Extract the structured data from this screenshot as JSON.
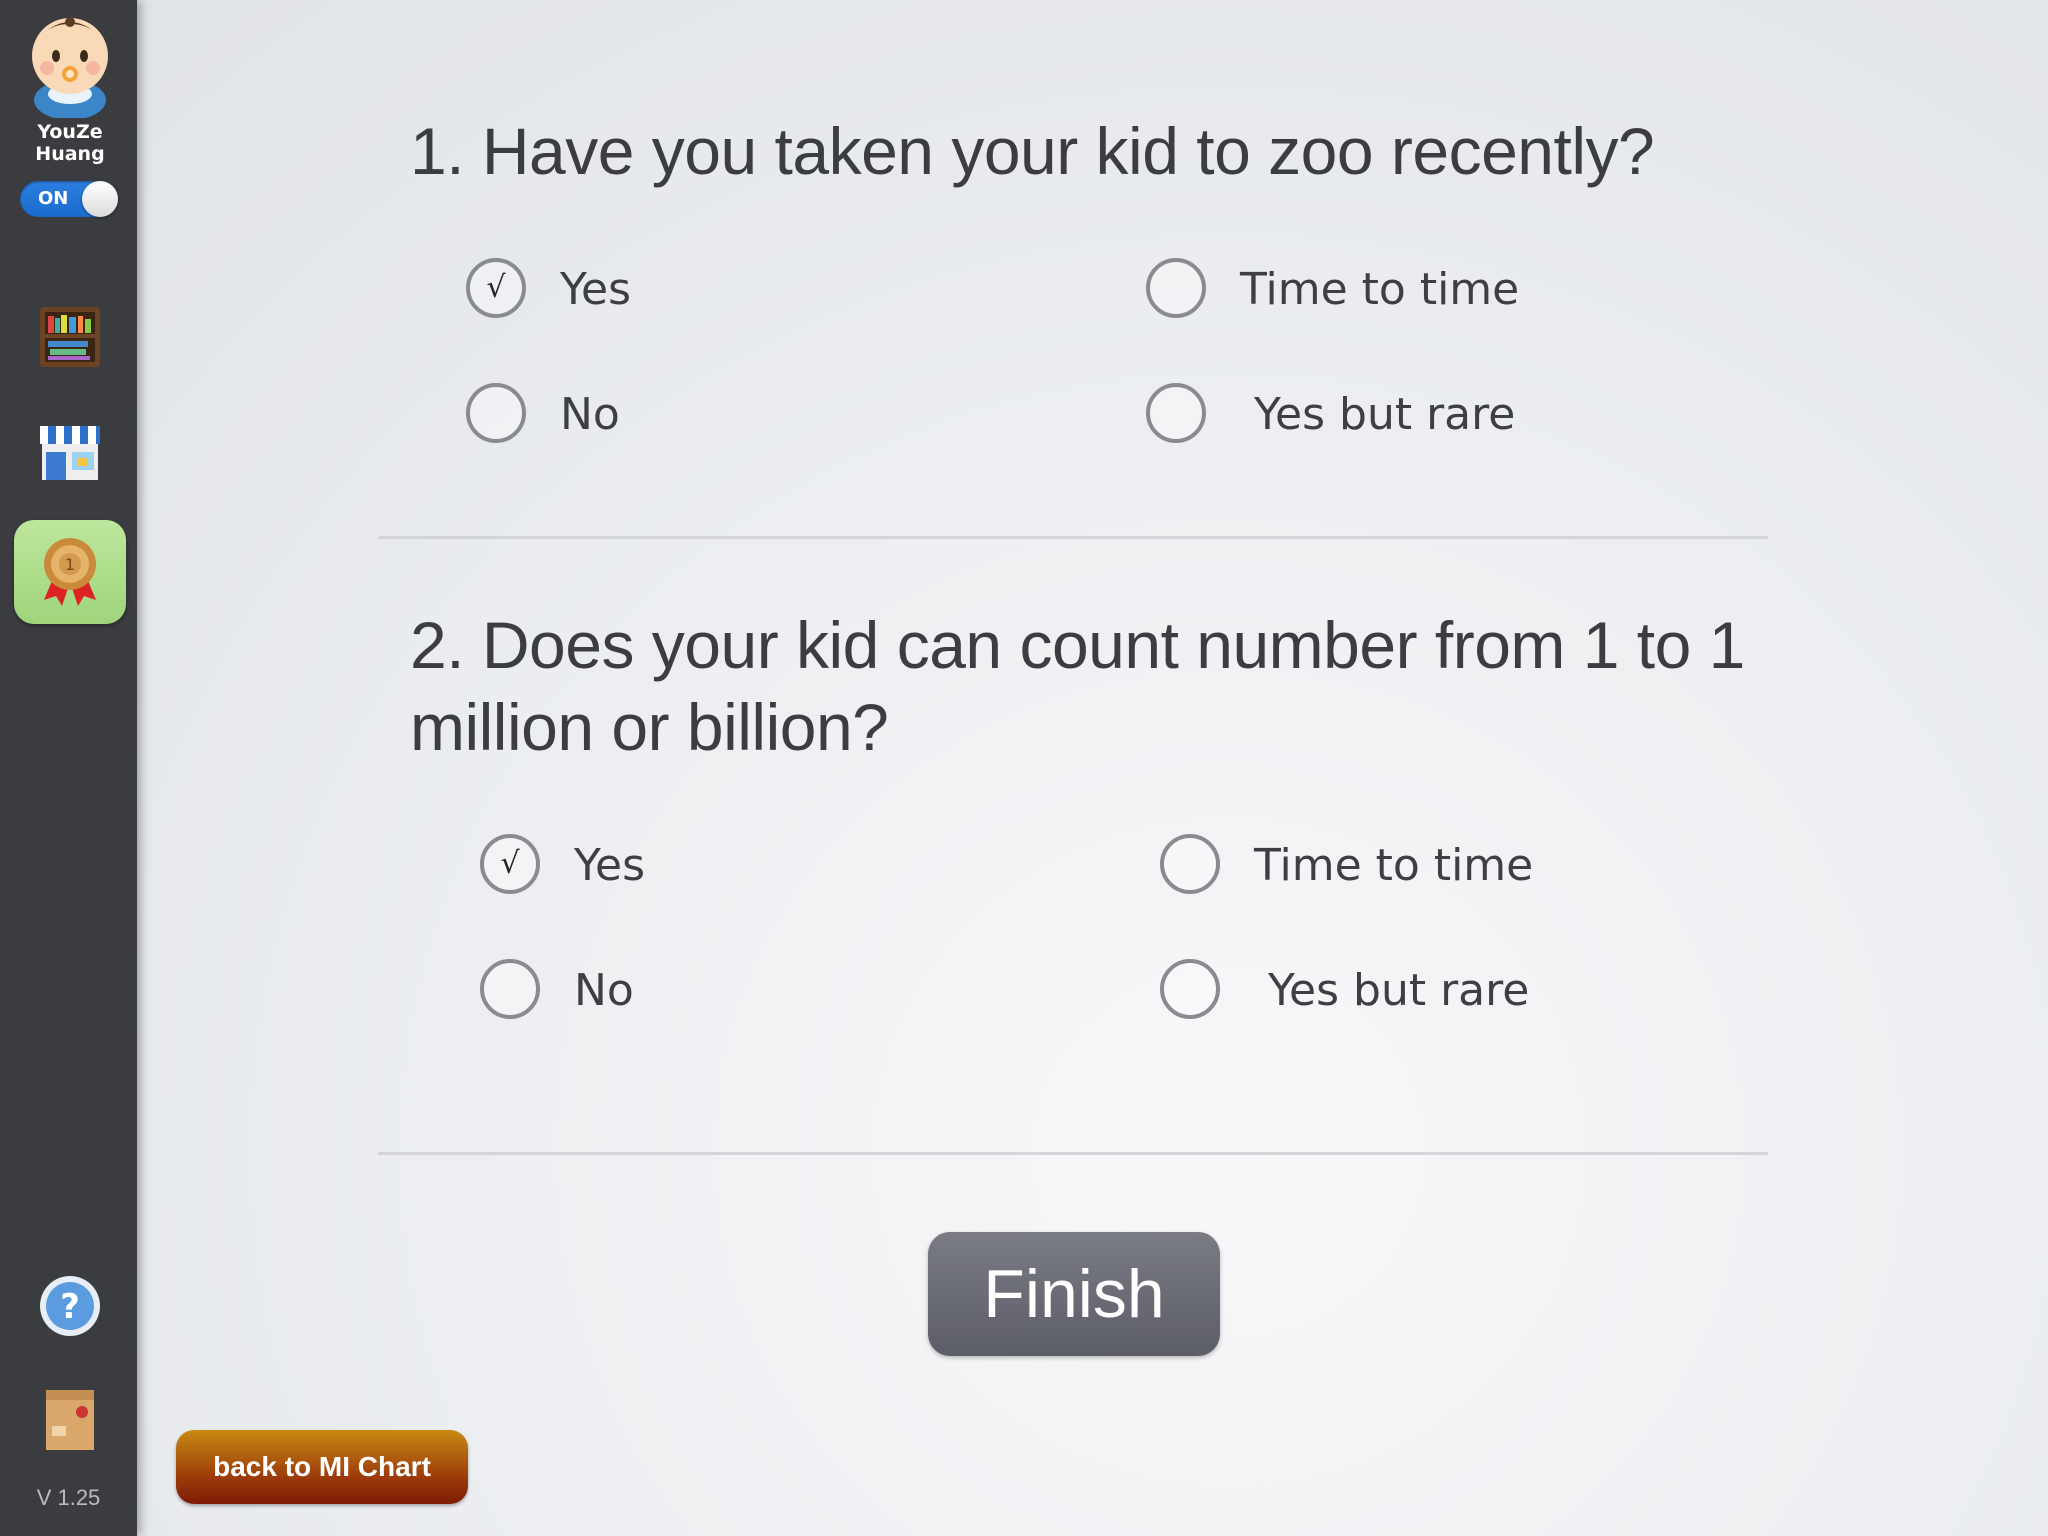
{
  "sidebar": {
    "user_name": "YouZe\nHuang",
    "toggle_label": "ON",
    "version": "V 1.25",
    "icons": [
      "bookshelf-icon",
      "store-icon",
      "medal-icon",
      "help-icon",
      "package-icon"
    ]
  },
  "questions": [
    {
      "text": "1. Have you taken your kid to zoo recently?",
      "options": [
        {
          "label": "Yes",
          "checked": true
        },
        {
          "label": "Time to time",
          "checked": false
        },
        {
          "label": "No",
          "checked": false
        },
        {
          "label": "Yes but rare",
          "checked": false
        }
      ]
    },
    {
      "text": "2. Does your kid can count number from 1 to 1 million or billion?",
      "options": [
        {
          "label": "Yes",
          "checked": true
        },
        {
          "label": "Time to time",
          "checked": false
        },
        {
          "label": "No",
          "checked": false
        },
        {
          "label": "Yes but rare",
          "checked": false
        }
      ]
    }
  ],
  "check_mark": "√",
  "finish_label": "Finish",
  "back_label": "back to MI Chart"
}
